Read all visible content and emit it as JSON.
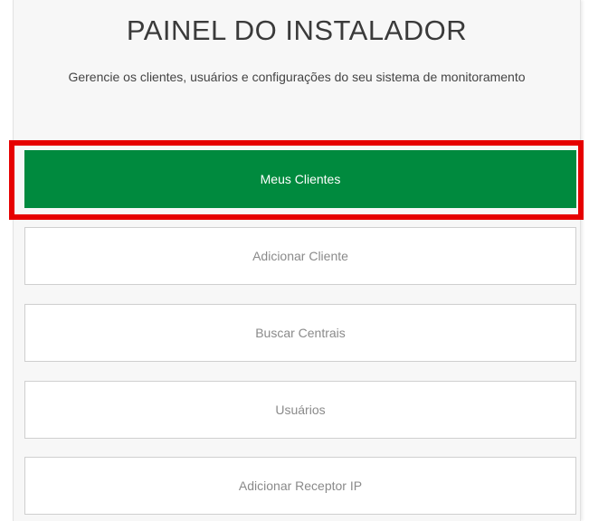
{
  "header": {
    "title": "PAINEL DO INSTALADOR",
    "subtitle": "Gerencie os clientes, usuários e configurações do seu sistema de monitoramento"
  },
  "menu": [
    {
      "label": "Meus Clientes",
      "active": true
    },
    {
      "label": "Adicionar Cliente",
      "active": false
    },
    {
      "label": "Buscar Centrais",
      "active": false
    },
    {
      "label": "Usuários",
      "active": false
    },
    {
      "label": "Adicionar Receptor IP",
      "active": false
    }
  ],
  "colors": {
    "accent_green": "#008a3e",
    "highlight_red": "#e60000",
    "panel_bg": "#f7f7f7"
  }
}
